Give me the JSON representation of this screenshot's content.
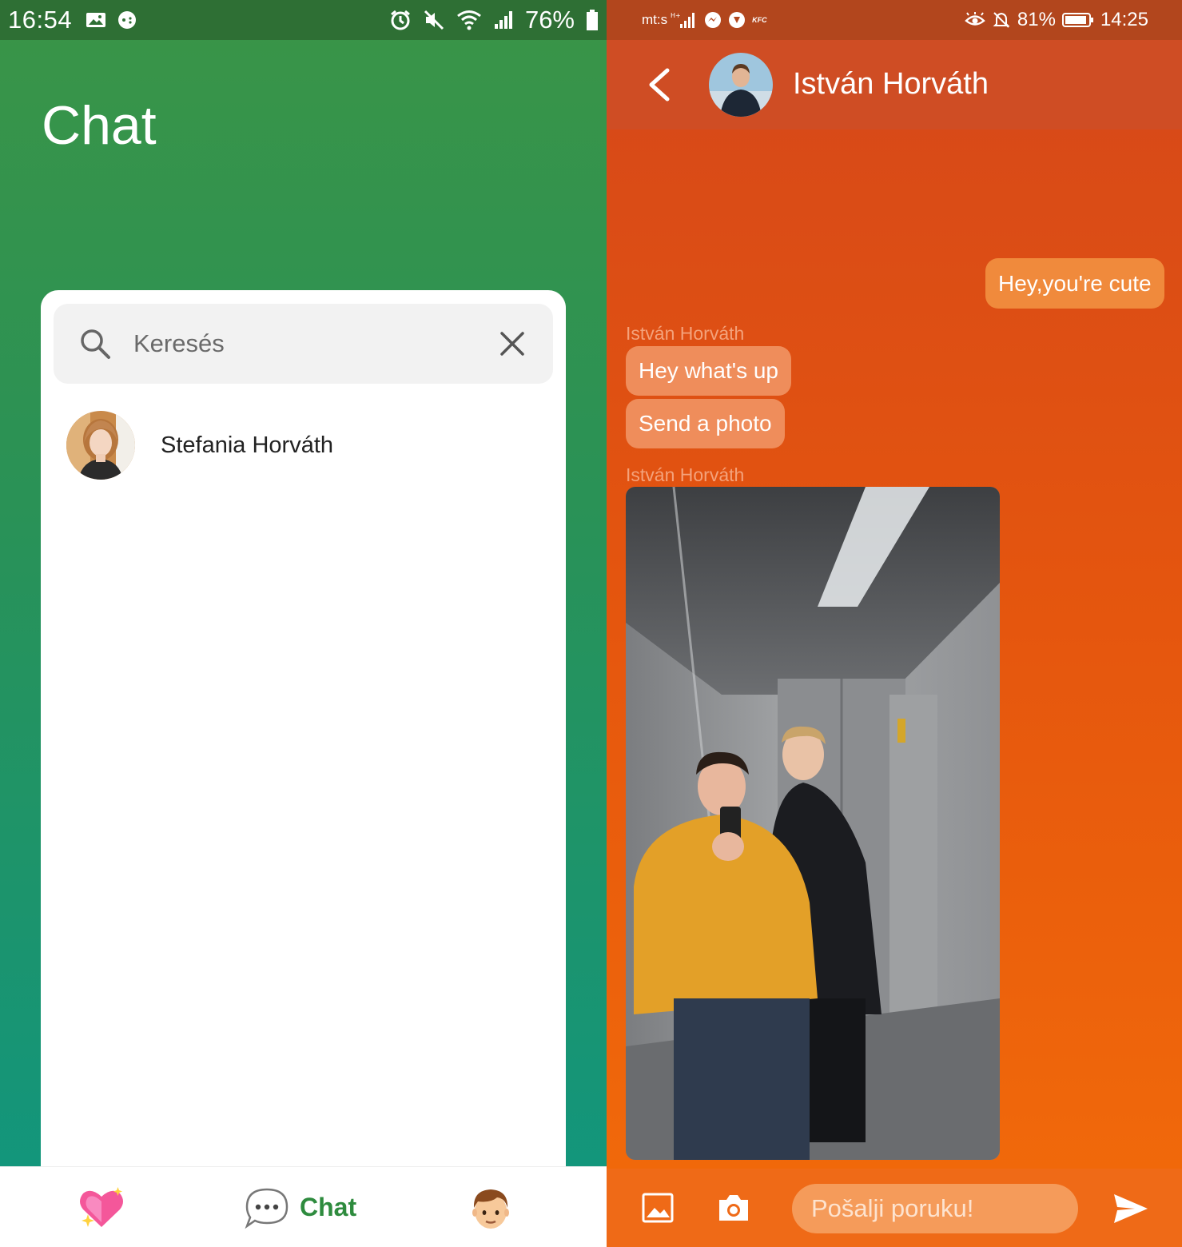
{
  "left": {
    "status_bar": {
      "time": "16:54",
      "battery_percent": "76%"
    },
    "page_title": "Chat",
    "search": {
      "placeholder": "Keresés"
    },
    "contacts": [
      {
        "name": "Stefania Horváth"
      }
    ],
    "bottom_nav": {
      "items": [
        {
          "icon": "sparkling-heart-icon",
          "active": false
        },
        {
          "icon": "speech-bubble-icon",
          "label": "Chat",
          "active": true
        },
        {
          "icon": "boy-face-icon",
          "active": false
        }
      ]
    },
    "colors": {
      "accent": "#2e8b3e",
      "header_bg": "#3a9447"
    }
  },
  "right": {
    "status_bar": {
      "carrier": "mt:s",
      "battery_percent": "81%",
      "time": "14:25"
    },
    "header": {
      "contact_name": "István Horváth"
    },
    "messages": [
      {
        "from": "me",
        "text": "Hey,you're cute"
      },
      {
        "from": "them",
        "sender": "István Horváth",
        "text": "Hey what's up"
      },
      {
        "from": "them",
        "text": "Send a photo"
      },
      {
        "from": "them",
        "sender": "István Horváth",
        "type": "image"
      }
    ],
    "composer": {
      "placeholder": "Pošalji poruku!"
    },
    "colors": {
      "accent": "#e5560e",
      "bubble_mine": "#f08a3c",
      "bubble_theirs": "#ef8d5b"
    }
  }
}
